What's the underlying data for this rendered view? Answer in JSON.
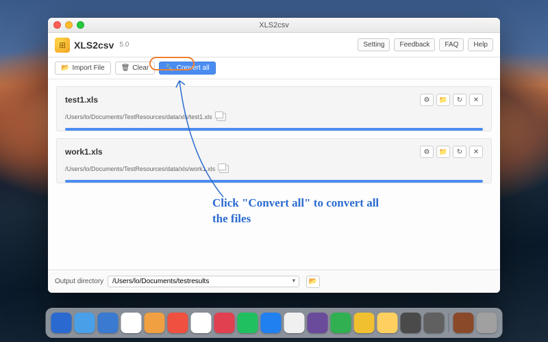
{
  "window": {
    "title": "XLS2csv"
  },
  "app": {
    "name": "XLS2csv",
    "version": "5.0"
  },
  "header_buttons": {
    "setting": "Setting",
    "feedback": "Feedback",
    "faq": "FAQ",
    "help": "Help"
  },
  "toolbar": {
    "import": "Import File",
    "clear": "Clear",
    "convert_all": "Convert all"
  },
  "files": [
    {
      "name": "test1.xls",
      "path": "/Users/lo/Documents/TestResources/data/xls/test1.xls"
    },
    {
      "name": "work1.xls",
      "path": "/Users/lo/Documents/TestResources/data/xls/work1.xls"
    }
  ],
  "footer": {
    "label": "Output directory",
    "path": "/Users/lo/Documents/testresults"
  },
  "annotation": "Click \"Convert all\" to convert all the files",
  "dock_colors": [
    "#2a6ad0",
    "#4aa0e8",
    "#3a7ad0",
    "#ffffff",
    "#f0a040",
    "#f05040",
    "#ffffff",
    "#e04050",
    "#20c060",
    "#2080f0",
    "#f0f0f0",
    "#6a4a9a",
    "#30b050",
    "#f0c030",
    "#ffd060",
    "#4a4a4a",
    "#606060",
    "#8a4a2a",
    "#a0a0a0"
  ]
}
